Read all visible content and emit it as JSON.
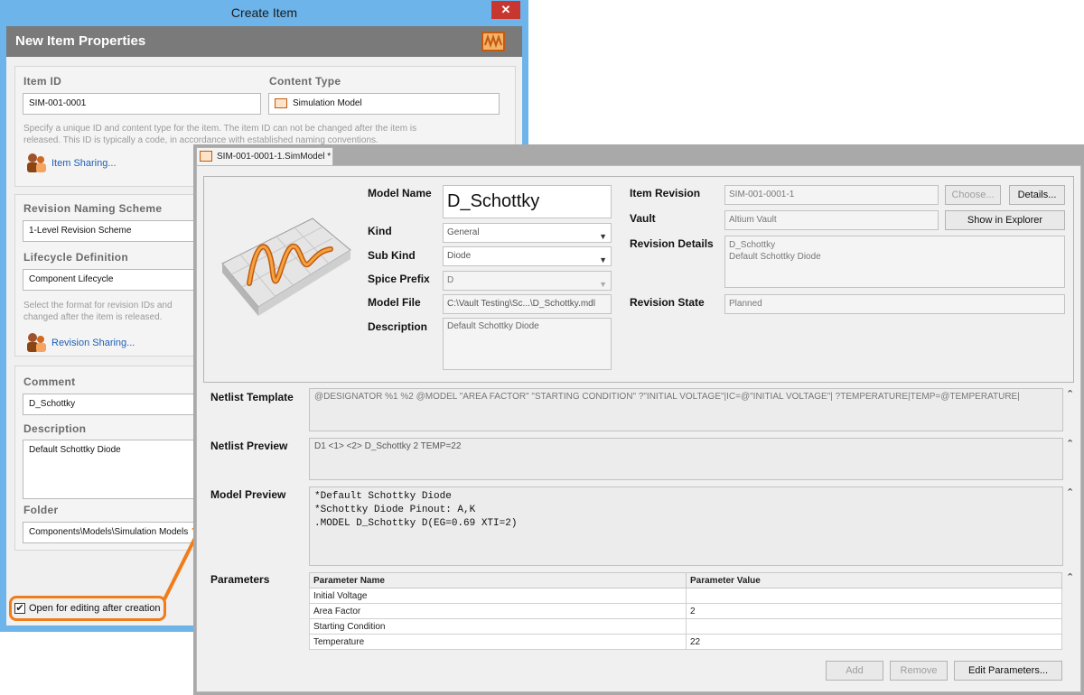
{
  "create_item": {
    "window_title": "Create Item",
    "close_glyph": "✕",
    "banner_title": "New Item Properties",
    "item_id_label": "Item ID",
    "item_id_value": "SIM-001-0001",
    "content_type_label": "Content Type",
    "content_type_value": "Simulation Model",
    "id_hint_line1": "Specify a unique ID and content type for the item. The item ID can not be changed after the item is",
    "id_hint_line2": "released. This ID is typically a code, in accordance with established naming conventions.",
    "item_sharing_link": "Item Sharing...",
    "revision_scheme_label": "Revision Naming Scheme",
    "revision_scheme_value": "1-Level Revision Scheme",
    "lifecycle_label": "Lifecycle Definition",
    "lifecycle_value": "Component Lifecycle",
    "format_hint_line1": "Select the format for revision IDs and",
    "format_hint_line2": "changed after the item is released.",
    "revision_sharing_link": "Revision Sharing...",
    "comment_label": "Comment",
    "comment_value": "D_Schottky",
    "description_label": "Description",
    "description_value": "Default Schottky Diode",
    "folder_label": "Folder",
    "folder_value": "Components\\Models\\Simulation Models",
    "open_for_editing_label": "Open for editing after creation",
    "open_for_editing_checked": true
  },
  "simmodel": {
    "tab_label": "SIM-001-0001-1.SimModel *",
    "model_name_label": "Model Name",
    "model_name_value": "D_Schottky",
    "kind_label": "Kind",
    "kind_value": "General",
    "sub_kind_label": "Sub Kind",
    "sub_kind_value": "Diode",
    "spice_prefix_label": "Spice Prefix",
    "spice_prefix_value": "D",
    "model_file_label": "Model File",
    "model_file_value": "C:\\Vault Testing\\Sc...\\D_Schottky.mdl",
    "description_label": "Description",
    "description_value": "Default Schottky Diode",
    "item_revision_label": "Item Revision",
    "item_revision_value": "SIM-001-0001-1",
    "choose_button": "Choose...",
    "details_button": "Details...",
    "vault_label": "Vault",
    "vault_value": "Altium Vault",
    "show_in_explorer_button": "Show in Explorer",
    "revision_details_label": "Revision Details",
    "revision_details_line1": "D_Schottky",
    "revision_details_line2": "Default Schottky Diode",
    "revision_state_label": "Revision State",
    "revision_state_value": "Planned",
    "netlist_template_label": "Netlist Template",
    "netlist_template_value": "@DESIGNATOR %1 %2 @MODEL \"AREA FACTOR\" \"STARTING CONDITION\" ?\"INITIAL VOLTAGE\"|IC=@\"INITIAL VOLTAGE\"| ?TEMPERATURE|TEMP=@TEMPERATURE|",
    "netlist_preview_label": "Netlist Preview",
    "netlist_preview_value": "D1 <1> <2> D_Schottky 2  TEMP=22",
    "model_preview_label": "Model Preview",
    "model_preview_line1": "*Default Schottky Diode",
    "model_preview_line2": "*Schottky Diode Pinout: A,K",
    "model_preview_line3": ".MODEL D_Schottky D(EG=0.69 XTI=2)",
    "parameters_label": "Parameters",
    "param_col_name": "Parameter Name",
    "param_col_value": "Parameter Value",
    "params": [
      {
        "name": "Initial Voltage",
        "value": ""
      },
      {
        "name": "Area Factor",
        "value": "2"
      },
      {
        "name": "Starting Condition",
        "value": ""
      },
      {
        "name": "Temperature",
        "value": "22"
      }
    ],
    "add_button": "Add",
    "remove_button": "Remove",
    "edit_parameters_button": "Edit Parameters...",
    "collapse_glyph": "⌃"
  },
  "colors": {
    "dialog_frame": "#6cb4ea",
    "accent_orange": "#f07d1a",
    "close_red": "#c7372f",
    "link_blue": "#1f5fb4"
  },
  "icons": [
    "close-icon",
    "simulation-model-icon",
    "item-sharing-icon",
    "revision-sharing-icon",
    "dropdown-arrow-icon",
    "checkbox-checked-icon",
    "model-thumbnail-icon",
    "collapse-caret-icon"
  ]
}
